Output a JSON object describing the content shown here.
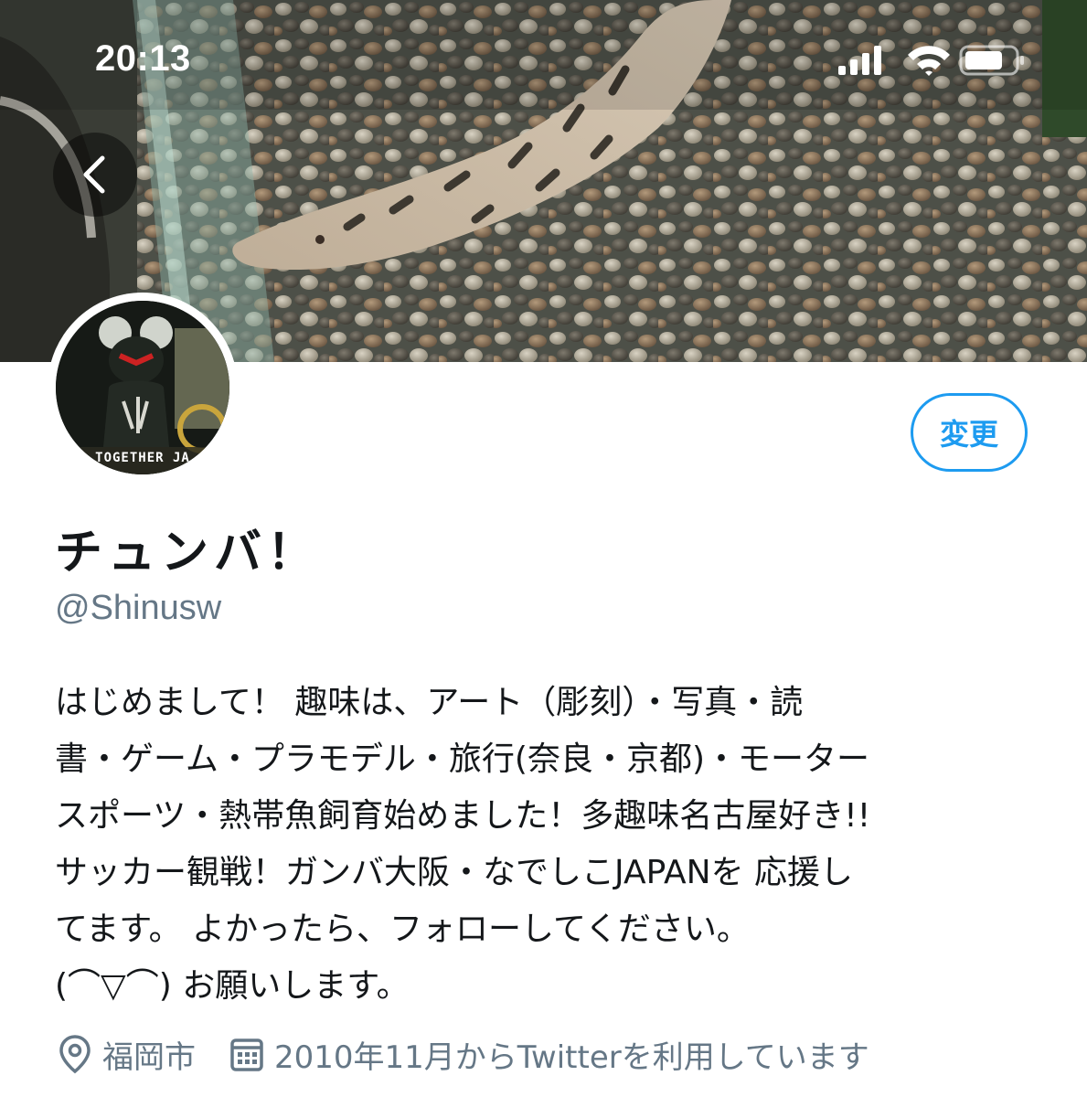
{
  "status_bar": {
    "time": "20:13"
  },
  "header": {
    "back_icon": "chevron-left-icon"
  },
  "profile": {
    "avatar_caption": "TOGETHER JA",
    "edit_button_label": "変更",
    "display_name": "チュンバ！",
    "handle": "@Shinusw",
    "bio_lines": [
      "はじめまして！ 趣味は、アート（彫刻）・写真・読",
      "書・ゲーム・プラモデル・旅行(奈良・京都)・モーター",
      "スポーツ・熱帯魚飼育始めました！多趣味名古屋好き!!",
      "サッカー観戦！ガンバ大阪・なでしこJAPANを 応援し",
      "てます。 よかったら、フォローしてください。",
      "(⌒▽⌒) お願いします。"
    ],
    "location": "福岡市",
    "joined": "2010年11月からTwitterを利用しています"
  },
  "colors": {
    "accent": "#1d9bf0",
    "secondary_text": "#657786",
    "primary_text": "#14171a"
  }
}
